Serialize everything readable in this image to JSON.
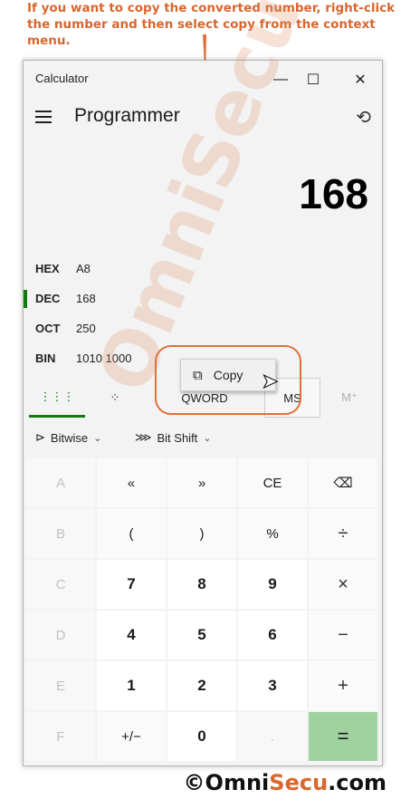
{
  "annotation": {
    "text": "If you want to copy the converted number, right-click the number and then select copy from the context menu."
  },
  "window": {
    "title": "Calculator",
    "minimize_glyph": "—",
    "maximize_glyph": "☐",
    "close_glyph": "✕"
  },
  "header": {
    "mode": "Programmer",
    "history_glyph": "⟲"
  },
  "display": {
    "value": "168"
  },
  "radix": [
    {
      "name": "HEX",
      "value": "A8",
      "selected": false
    },
    {
      "name": "DEC",
      "value": "168",
      "selected": true
    },
    {
      "name": "OCT",
      "value": "250",
      "selected": false
    },
    {
      "name": "BIN",
      "value": "1010 1000",
      "selected": false
    }
  ],
  "tabs": {
    "keypad_glyph": "⋮⋮⋮",
    "bit_glyph": "⁘",
    "word_size": "QWORD",
    "memory_store": "MS",
    "memory_plus": "M⁺"
  },
  "tools": {
    "bitwise_glyph": "⊳",
    "bitwise_label": "Bitwise",
    "bitshift_glyph": "⋙",
    "bitshift_label": "Bit Shift",
    "chevron": "⌄"
  },
  "context_menu": {
    "copy_label": "Copy",
    "copy_glyph": "⧉"
  },
  "keys": [
    [
      "A",
      "«",
      "»",
      "CE",
      "⌫"
    ],
    [
      "B",
      "(",
      ")",
      "%",
      "÷"
    ],
    [
      "C",
      "7",
      "8",
      "9",
      "×"
    ],
    [
      "D",
      "4",
      "5",
      "6",
      "−"
    ],
    [
      "E",
      "1",
      "2",
      "3",
      "+"
    ],
    [
      "F",
      "+/−",
      "0",
      ".",
      "="
    ]
  ],
  "watermark": {
    "text": "OmniSecu.com"
  },
  "footer": {
    "copyright": "©",
    "brand_main": "Omni",
    "brand_accent": "Secu",
    "brand_tld": ".com"
  },
  "colors": {
    "accent_green": "#107c10",
    "equals_bg": "#9fd29f",
    "annotation_orange": "#d9662c"
  }
}
